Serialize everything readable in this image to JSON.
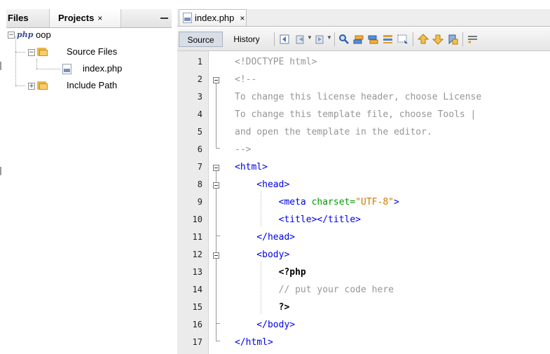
{
  "left_panel": {
    "tabs": [
      {
        "label": "Files"
      },
      {
        "label": "Projects",
        "close": "×"
      }
    ],
    "tree": {
      "project": "oop",
      "source_files": "Source Files",
      "file": "index.php",
      "include_path": "Include Path"
    }
  },
  "editor": {
    "tab": {
      "label": "index.php",
      "close": "×"
    },
    "toolbar": {
      "source": "Source",
      "history": "History"
    },
    "lines": [
      {
        "n": "1",
        "segments": [
          {
            "t": "<!DOCTYPE html>",
            "c": "gray"
          }
        ]
      },
      {
        "n": "2",
        "segments": [
          {
            "t": "<!--",
            "c": "gray"
          }
        ]
      },
      {
        "n": "3",
        "segments": [
          {
            "t": "To change this license header, choose License",
            "c": "gray"
          }
        ]
      },
      {
        "n": "4",
        "segments": [
          {
            "t": "To change this template file, choose Tools |",
            "c": "gray"
          }
        ]
      },
      {
        "n": "5",
        "segments": [
          {
            "t": "and open the template in the editor.",
            "c": "gray"
          }
        ]
      },
      {
        "n": "6",
        "segments": [
          {
            "t": "-->",
            "c": "gray"
          }
        ]
      },
      {
        "n": "7",
        "segments": [
          {
            "t": "<html>",
            "c": "blue"
          }
        ]
      },
      {
        "n": "8",
        "segments": [
          {
            "t": "    <head>",
            "c": "blue"
          }
        ]
      },
      {
        "n": "9",
        "segments": [
          {
            "t": "        <meta ",
            "c": "blue"
          },
          {
            "t": "charset=",
            "c": "green"
          },
          {
            "t": "\"UTF-8\"",
            "c": "orange"
          },
          {
            "t": ">",
            "c": "blue"
          }
        ]
      },
      {
        "n": "10",
        "segments": [
          {
            "t": "        <title></title>",
            "c": "blue"
          }
        ]
      },
      {
        "n": "11",
        "segments": [
          {
            "t": "    </head>",
            "c": "blue"
          }
        ]
      },
      {
        "n": "12",
        "segments": [
          {
            "t": "    <body>",
            "c": "blue"
          }
        ]
      },
      {
        "n": "13",
        "segments": [
          {
            "t": "        <?php",
            "c": "black"
          }
        ]
      },
      {
        "n": "14",
        "segments": [
          {
            "t": "        // put your code here",
            "c": "gray"
          }
        ]
      },
      {
        "n": "15",
        "segments": [
          {
            "t": "        ?>",
            "c": "black"
          }
        ]
      },
      {
        "n": "16",
        "segments": [
          {
            "t": "    </body>",
            "c": "blue"
          }
        ]
      },
      {
        "n": "17",
        "segments": [
          {
            "t": "</html>",
            "c": "blue"
          }
        ]
      }
    ]
  }
}
